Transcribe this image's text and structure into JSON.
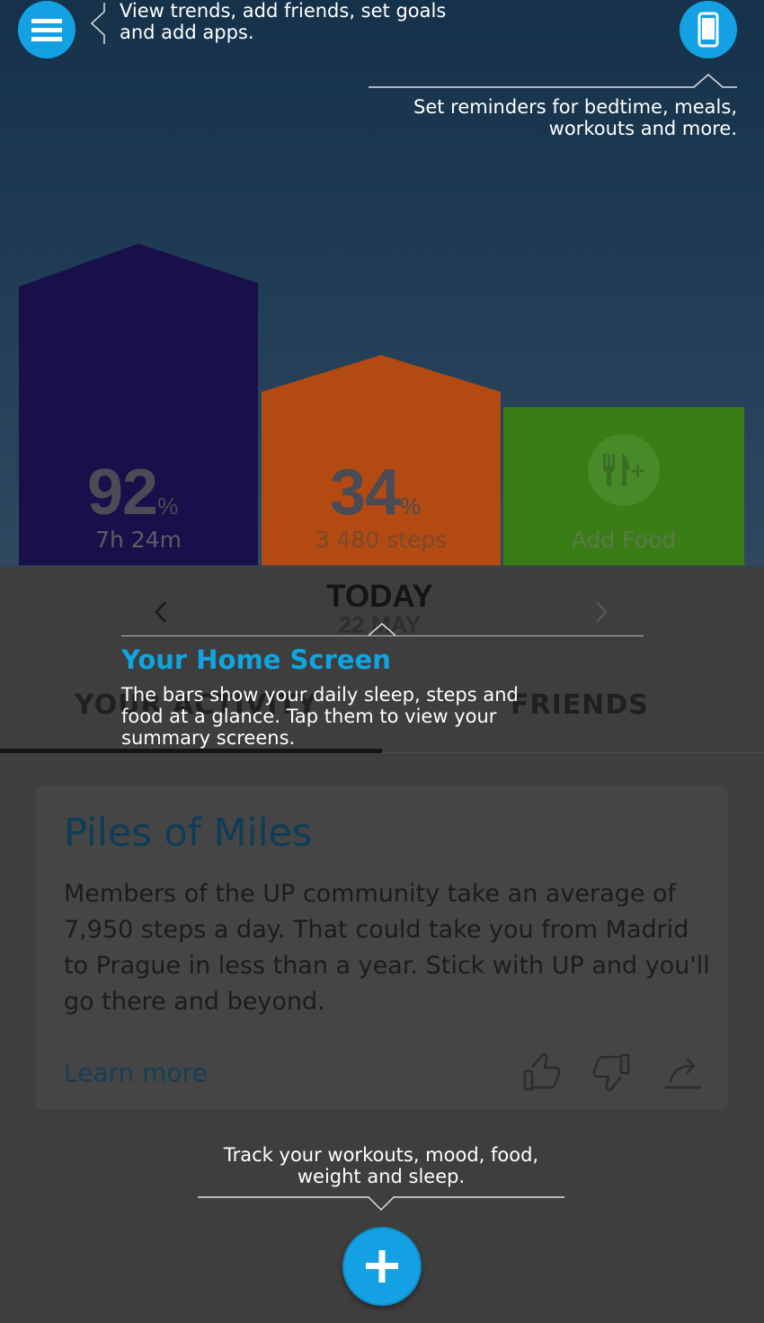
{
  "colors": {
    "accent": "#13a1e3",
    "sleep_bar": "#17104a",
    "steps_bar": "#b34a12",
    "food_bar": "#3a7c15",
    "tip_title": "#0fa5e0"
  },
  "header": {
    "menu_icon": "hamburger-menu-icon",
    "menu_tip": [
      "View trends, add friends, set goals",
      "and add apps."
    ],
    "reminder_icon": "phone-icon",
    "reminder_tip": [
      "Set reminders for bedtime, meals,",
      "workouts and more."
    ]
  },
  "bars": {
    "sleep": {
      "percent": "92",
      "percent_symbol": "%",
      "detail": "7h 24m"
    },
    "steps": {
      "percent": "34",
      "percent_symbol": "%",
      "detail": "3 480 steps"
    },
    "food": {
      "icon": "fork-knife-plus-icon",
      "label": "Add Food"
    }
  },
  "date": {
    "title": "TODAY",
    "day": "22 MAY",
    "prev_icon": "chevron-left-icon",
    "next_icon": "chevron-right-icon"
  },
  "tutorial": {
    "title": "Your Home Screen",
    "body": [
      "The bars show your daily sleep, steps and",
      "food at a glance. Tap them to view your",
      "summary screens."
    ]
  },
  "tabs": {
    "activity": "YOUR ACTIVITY",
    "friends": "FRIENDS"
  },
  "card": {
    "title": "Piles of Miles",
    "body": "Members of the UP community take an average of 7,950 steps a day. That could take you from Madrid to Prague in less than a year. Stick with UP and you'll go there and beyond.",
    "link": "Learn more",
    "actions": [
      "thumbs-up-icon",
      "thumbs-down-icon",
      "share-icon"
    ]
  },
  "footer": {
    "tip": [
      "Track your workouts, mood, food,",
      "weight and sleep."
    ],
    "add_icon": "plus-icon"
  }
}
